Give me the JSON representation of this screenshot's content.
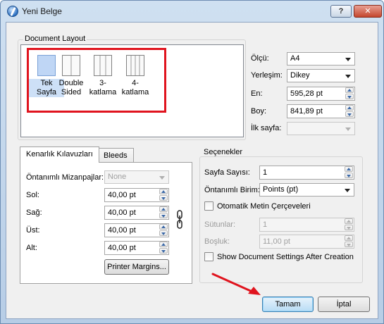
{
  "window": {
    "title": "Yeni Belge",
    "help_label": "?",
    "close_label": "✕"
  },
  "document_layout": {
    "title": "Document Layout",
    "items": [
      {
        "label_line1": "Tek",
        "label_line2": "Sayfa"
      },
      {
        "label_line1": "Double",
        "label_line2": "Sided"
      },
      {
        "label_line1": "3-",
        "label_line2": "katlama"
      },
      {
        "label_line1": "4-",
        "label_line2": "katlama"
      }
    ]
  },
  "page_props": {
    "size_label": "Ölçü:",
    "size_value": "A4",
    "orientation_label": "Yerleşim:",
    "orientation_value": "Dikey",
    "width_label": "En:",
    "width_value": "595,28 pt",
    "height_label": "Boy:",
    "height_value": "841,89 pt",
    "first_page_label": "İlk sayfa:",
    "first_page_value": ""
  },
  "tabs": [
    {
      "label": "Kenarlık Kılavuzları"
    },
    {
      "label": "Bleeds"
    }
  ],
  "margins": {
    "preset_label": "Öntanımlı Mizanpajlar:",
    "preset_value": "None",
    "left_label": "Sol:",
    "left_value": "40,00 pt",
    "right_label": "Sağ:",
    "right_value": "40,00 pt",
    "top_label": "Üst:",
    "top_value": "40,00 pt",
    "bottom_label": "Alt:",
    "bottom_value": "40,00 pt",
    "printer_margins_label": "Printer Margins..."
  },
  "options": {
    "title": "Seçenekler",
    "pages_label": "Sayfa Sayısı:",
    "pages_value": "1",
    "unit_label": "Öntanımlı Birim:",
    "unit_value": "Points (pt)",
    "auto_frames_label": "Otomatik Metin Çerçeveleri",
    "columns_label": "Sütunlar:",
    "columns_value": "1",
    "gap_label": "Boşluk:",
    "gap_value": "11,00 pt",
    "show_settings_label": "Show Document Settings After Creation"
  },
  "buttons": {
    "ok_label": "Tamam",
    "cancel_label": "İptal"
  },
  "colors": {
    "highlight": "#e0141e",
    "arrow": "#e0141e"
  }
}
